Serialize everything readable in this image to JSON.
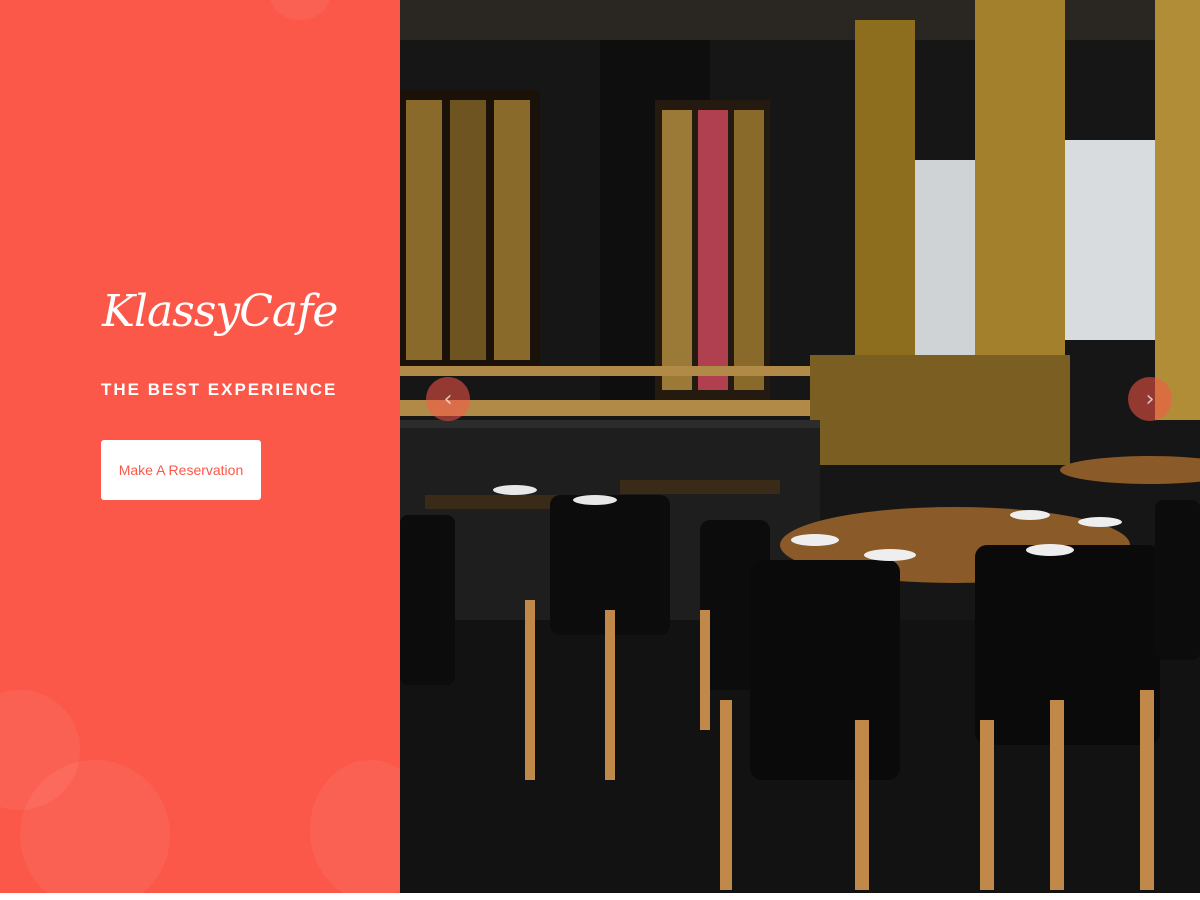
{
  "hero": {
    "logo_text": "KlassyCafe",
    "tagline": "THE BEST EXPERIENCE",
    "reserve_button_label": "Make A Reservation",
    "accent_color": "#fb5849"
  },
  "slider": {
    "prev_icon": "‹",
    "next_icon": "›",
    "image_alt": "Restaurant interior with tables and chairs"
  }
}
